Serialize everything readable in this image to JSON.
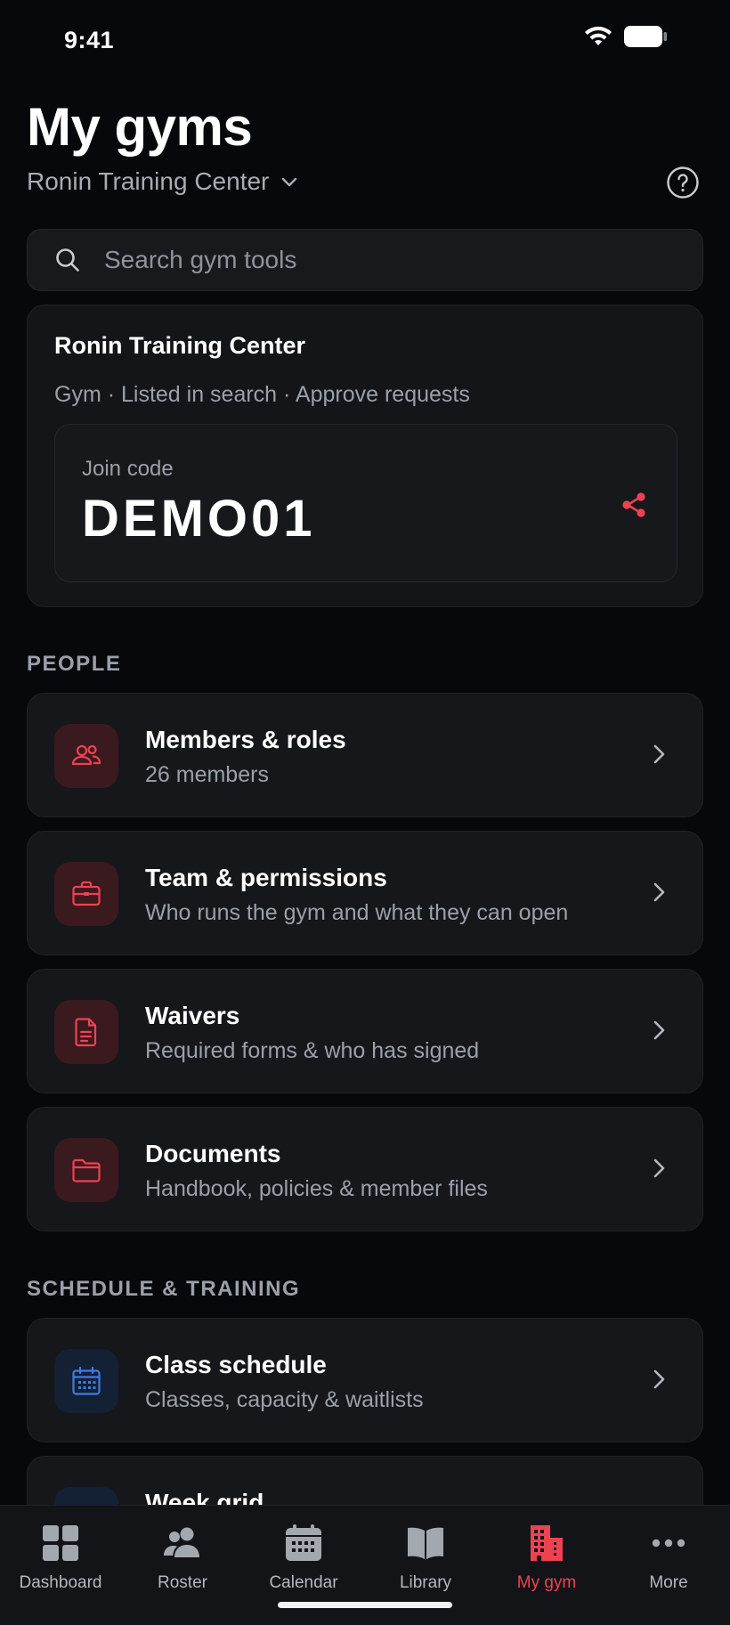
{
  "status": {
    "time": "9:41"
  },
  "header": {
    "title": "My gyms",
    "gym_selector": "Ronin Training Center"
  },
  "search": {
    "placeholder": "Search gym tools"
  },
  "gym_card": {
    "name": "Ronin Training Center",
    "meta": "Gym · Listed in search · Approve requests",
    "join_label": "Join code",
    "join_code": "DEMO01"
  },
  "sections": {
    "people": {
      "label": "PEOPLE",
      "items": [
        {
          "title": "Members & roles",
          "subtitle": "26 members",
          "icon": "people-icon"
        },
        {
          "title": "Team & permissions",
          "subtitle": "Who runs the gym and what they can open",
          "icon": "briefcase-icon"
        },
        {
          "title": "Waivers",
          "subtitle": "Required forms & who has signed",
          "icon": "document-icon"
        },
        {
          "title": "Documents",
          "subtitle": "Handbook, policies & member files",
          "icon": "folder-icon"
        }
      ]
    },
    "schedule": {
      "label": "SCHEDULE & TRAINING",
      "items": [
        {
          "title": "Class schedule",
          "subtitle": "Classes, capacity & waitlists",
          "icon": "calendar-icon"
        },
        {
          "title": "Week grid",
          "subtitle": "",
          "icon": "grid-icon"
        }
      ]
    }
  },
  "tabs": [
    {
      "label": "Dashboard",
      "icon": "dashboard-icon"
    },
    {
      "label": "Roster",
      "icon": "roster-icon"
    },
    {
      "label": "Calendar",
      "icon": "calendar-icon"
    },
    {
      "label": "Library",
      "icon": "book-icon"
    },
    {
      "label": "My gym",
      "icon": "building-icon",
      "active": true
    },
    {
      "label": "More",
      "icon": "more-icon"
    }
  ],
  "colors": {
    "accent": "#ee4250",
    "background": "#07080b",
    "card": "#16171b",
    "blue_accent": "#3f7be6"
  }
}
